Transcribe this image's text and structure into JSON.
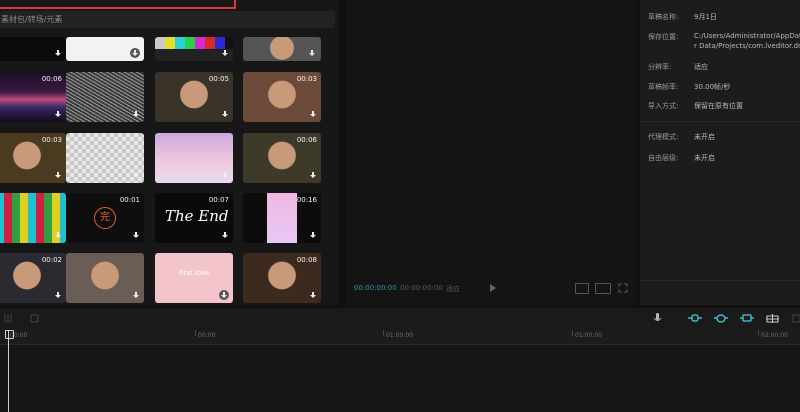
{
  "media": {
    "breadcrumb": "素材包/转场/元素",
    "breadcrumb_prefix": "素材包",
    "thumbs": [
      {
        "name": "thumb-black-1",
        "dur": "",
        "color": "#0b0b0b",
        "dl": "plain"
      },
      {
        "name": "thumb-white",
        "dur": "",
        "color": "#f2f2f2",
        "dl": "circle"
      },
      {
        "name": "thumb-colorbars",
        "dur": "",
        "color": "#222",
        "dl": "plain"
      },
      {
        "name": "thumb-man-face",
        "dur": "",
        "color": "#555",
        "dl": "circle"
      },
      {
        "name": "thumb-lines",
        "dur": "00:06",
        "color": "#2a1530",
        "dl": "plain"
      },
      {
        "name": "thumb-static",
        "dur": "",
        "color": "#6a6a6a",
        "dl": "plain"
      },
      {
        "name": "thumb-two-men",
        "dur": "00:05",
        "color": "#3a332a",
        "dl": "plain"
      },
      {
        "name": "thumb-smile-woman",
        "dur": "00:03",
        "color": "#6b4a3a",
        "dl": "plain"
      },
      {
        "name": "thumb-laughing-man",
        "dur": "00:03",
        "color": "#4a3a20",
        "dl": "plain"
      },
      {
        "name": "thumb-transparent",
        "dur": "",
        "color": "#dcdcdc",
        "dl": "plain"
      },
      {
        "name": "thumb-pink-clouds",
        "dur": "",
        "color": "#d8b8de",
        "dl": "plain"
      },
      {
        "name": "thumb-desert-figure",
        "dur": "00:06",
        "color": "#3e3a2a",
        "dl": "plain"
      },
      {
        "name": "thumb-test-card",
        "dur": "",
        "color": "#777",
        "dl": "plain"
      },
      {
        "name": "thumb-wan-circle",
        "dur": "00:01",
        "color": "#0e0e0e",
        "dl": "plain"
      },
      {
        "name": "thumb-the-end",
        "dur": "00:07",
        "color": "#0a0a0a",
        "dl": "plain"
      },
      {
        "name": "thumb-pink-vertical",
        "dur": "00:16",
        "color": "#0c0c0c",
        "dl": "plain"
      },
      {
        "name": "thumb-men-suits",
        "dur": "00:02",
        "color": "#2a2a30",
        "dl": "plain"
      },
      {
        "name": "thumb-dancing-woman",
        "dur": "",
        "color": "#6a5d55",
        "dl": "plain"
      },
      {
        "name": "thumb-pink-text",
        "dur": "",
        "color": "#f4c4cc",
        "dl": "circle"
      },
      {
        "name": "thumb-man-close",
        "dur": "00:08",
        "color": "#3d2a1e",
        "dl": "plain"
      }
    ],
    "wan_char": "完",
    "the_end_text": "The End",
    "pink_small_text": "first love"
  },
  "preview": {
    "time_current": "00:00:00:00",
    "time_total": "00:00:00:00",
    "ratio_label": "适应"
  },
  "props": {
    "rows": [
      {
        "label": "草稿名称:",
        "value": "9月1日"
      },
      {
        "label": "保存位置:",
        "value": "C:/Users/Administrator/AppData/Local/JianyingPro/User Data/Projects/com.lveditor.draft"
      },
      {
        "label": "分辨率:",
        "value": "适应"
      },
      {
        "label": "草稿帧率:",
        "value": "30.00帧/秒"
      },
      {
        "label": "导入方式:",
        "value": "保留在原有位置"
      },
      {
        "label": "代理模式:",
        "value": "未开启"
      },
      {
        "label": "自由层级:",
        "value": "未开启"
      }
    ],
    "path_line1": "C:/Users/Administrator/AppDat",
    "path_line2": "r Data/Projects/com.lveditor.dr"
  },
  "timeline": {
    "ticks": [
      {
        "label": "00:00"
      },
      {
        "label": "00:00"
      },
      {
        "label": "01:00:00"
      },
      {
        "label": "01:00:00"
      },
      {
        "label": "02:00:00"
      }
    ]
  },
  "colors": {
    "accent": "#3ab8c8",
    "highlight_border": "#d63a3a"
  }
}
